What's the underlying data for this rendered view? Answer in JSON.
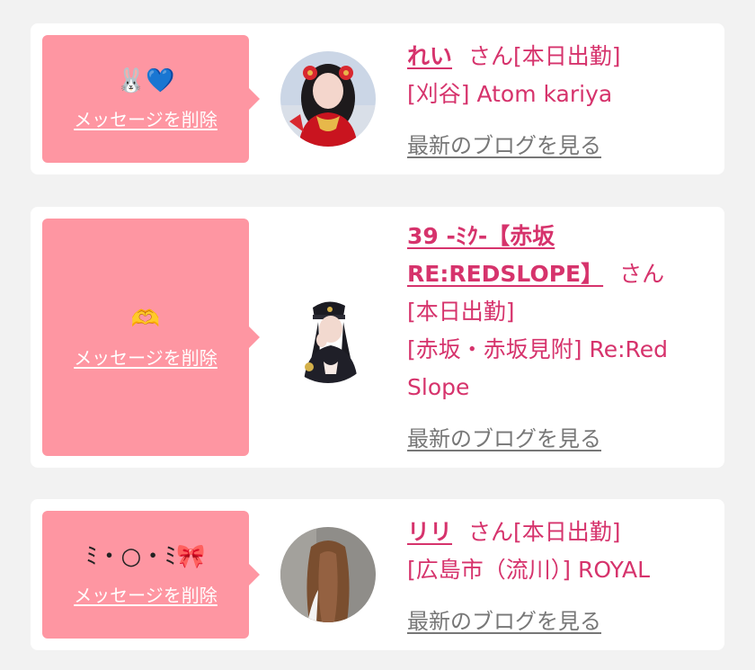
{
  "cards": [
    {
      "message": "🐰💙",
      "delete_label": "メッセージを削除",
      "name": "れい",
      "honorific": "さん",
      "status": "[本日出勤]",
      "shop": "[刈谷] Atom kariya",
      "blog_link": "最新のブログを見る",
      "avatar": "cast-photo-red-dress-icon"
    },
    {
      "message": "🫶",
      "delete_label": "メッセージを削除",
      "name_line1": "39 -ﾐｸ-【赤坂",
      "name_line2": "RE:REDSLOPE】",
      "honorific": "さん",
      "status": "[本日出勤]",
      "shop_line1": "[赤坂・赤坂見附] Re:Red",
      "shop_line2": "Slope",
      "blog_link": "最新のブログを見る",
      "avatar": "cast-photo-police-costume-icon"
    },
    {
      "message": "ﾐ・○・ﾐ🎀",
      "delete_label": "メッセージを削除",
      "name": "リリ",
      "honorific": "さん",
      "status": "[本日出勤]",
      "shop": "[広島市（流川）] ROYAL",
      "blog_link": "最新のブログを見る",
      "avatar": "cast-photo-back-view-icon"
    }
  ],
  "colors": {
    "page_background": "#f2f2f2",
    "card_background": "#ffffff",
    "message_box": "#fe96a2",
    "accent": "#d6336c",
    "link_gray": "#777777"
  }
}
